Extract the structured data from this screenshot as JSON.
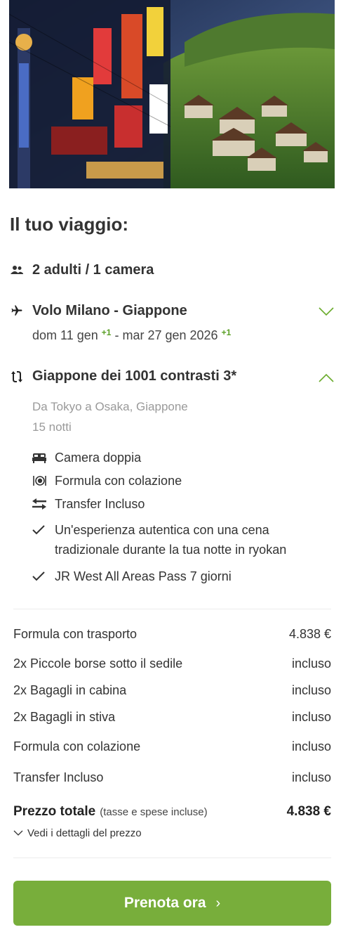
{
  "trip": {
    "title": "Il tuo viaggio:",
    "guests": "2 adulti / 1 camera",
    "flight": {
      "title": "Volo Milano - Giappone",
      "depart": "dom 11 gen",
      "depart_plus": "+1",
      "separator": " - ",
      "return": "mar 27 gen 2026",
      "return_plus": "+1"
    },
    "tour": {
      "title": "Giappone dei 1001 contrasti 3*",
      "location": "Da Tokyo a Osaka, Giappone",
      "nights": "15 notti",
      "features": [
        {
          "icon": "bed-icon",
          "label": "Camera doppia"
        },
        {
          "icon": "meal-icon",
          "label": "Formula con colazione"
        },
        {
          "icon": "transfer-icon",
          "label": "Transfer Incluso"
        },
        {
          "icon": "check-icon",
          "label": "Un'esperienza autentica con una cena tradizionale durante la tua notte in ryokan"
        },
        {
          "icon": "check-icon",
          "label": "JR West All Areas Pass 7 giorni"
        }
      ]
    }
  },
  "price": {
    "lines": [
      {
        "label": "Formula con trasporto",
        "value": "4.838 €"
      },
      {
        "label": "2x Piccole borse sotto il sedile",
        "value": "incluso"
      },
      {
        "label": "2x Bagagli in cabina",
        "value": "incluso"
      },
      {
        "label": "2x Bagagli in stiva",
        "value": "incluso"
      },
      {
        "label": "Formula con colazione",
        "value": "incluso"
      },
      {
        "label": "Transfer Incluso",
        "value": "incluso"
      }
    ],
    "total_label": "Prezzo totale",
    "total_note": "(tasse e spese incluse)",
    "total_value": "4.838 €",
    "details_link": "Vedi i dettagli del prezzo"
  },
  "cta": {
    "label": "Prenota ora",
    "arrow": "›"
  },
  "colors": {
    "accent": "#78ae3b",
    "accent_text": "#5a9f25",
    "muted": "#9a9a9a"
  }
}
